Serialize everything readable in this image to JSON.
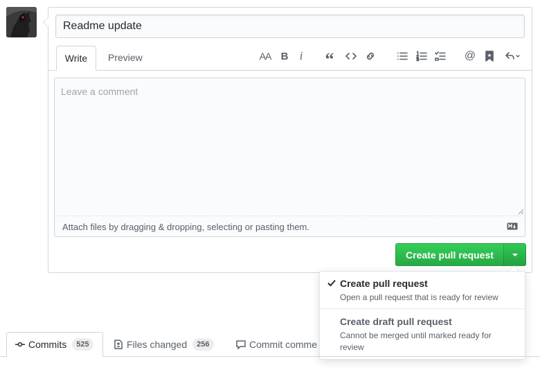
{
  "pr_form": {
    "title_value": "Readme update",
    "tabs": [
      {
        "label": "Write"
      },
      {
        "label": "Preview"
      }
    ],
    "toolbar": {
      "heading_glyph": "AA",
      "bold_glyph": "B",
      "italic_glyph": "i",
      "quote_glyph": "“",
      "mention_glyph": "@"
    },
    "comment_placeholder": "Leave a comment",
    "attach_text": "Attach files by dragging & dropping, selecting or pasting them.",
    "create_button_label": "Create pull request"
  },
  "dropdown": {
    "items": [
      {
        "title": "Create pull request",
        "description": "Open a pull request that is ready for review",
        "selected": true
      },
      {
        "title": "Create draft pull request",
        "description": "Cannot be merged until marked ready for review",
        "selected": false
      }
    ]
  },
  "bottom_tabs": [
    {
      "label": "Commits",
      "count": "525"
    },
    {
      "label": "Files changed",
      "count": "256"
    },
    {
      "label": "Commit comme"
    }
  ],
  "colors": {
    "primary_green": "#28a745",
    "border": "#d1d5da",
    "muted_text": "#586069"
  }
}
